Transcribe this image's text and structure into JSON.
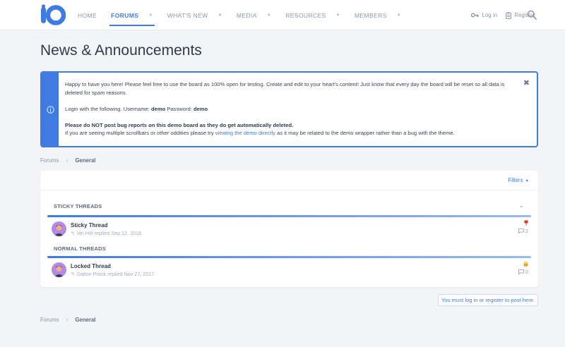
{
  "logo": {
    "text": "iO"
  },
  "nav": {
    "items": [
      {
        "label": "HOME",
        "caret": false,
        "active": false
      },
      {
        "label": "FORUMS",
        "caret": true,
        "active": true
      },
      {
        "label": "WHAT'S NEW",
        "caret": true,
        "active": false
      },
      {
        "label": "MEDIA",
        "caret": true,
        "active": false
      },
      {
        "label": "RESOURCES",
        "caret": true,
        "active": false
      },
      {
        "label": "MEMBERS",
        "caret": true,
        "active": false
      }
    ],
    "login_label": "Log in",
    "register_label": "Register"
  },
  "page": {
    "title": "News & Announcements"
  },
  "notice": {
    "line1": "Happy to have you here! Please feel free to use the board as 100% open for testing. Create and edit to your heart's content! Just know that every day the board will be reset so all data is deleted for spam reasons.",
    "login_prefix": "Login with the following. Username: ",
    "username": "demo",
    "password_prefix": " Password: ",
    "password": "demo",
    "warning": "Please do NOT post bug reports on this demo board as they do get automatically deleted.",
    "scroll_prefix": "If you are seeing multiple scrollbars or other oddities please try ",
    "scroll_link": "viewing the demo directly",
    "scroll_suffix": " as it may be related to the demo wrapper rather than a bug with the theme.",
    "close_glyph": "✖"
  },
  "breadcrumb": {
    "home": "Forums",
    "current": "General"
  },
  "threads": {
    "filters_label": "Filters",
    "sticky_header": "STICKY THREADS",
    "normal_header": "NORMAL THREADS",
    "sticky": [
      {
        "title": "Sticky Thread",
        "author": "Ian Hitt",
        "replied": "replied",
        "date": "Sep 12, 2018",
        "replies": "2",
        "status_icon": "pin-icon"
      }
    ],
    "normal": [
      {
        "title": "Locked Thread",
        "author": "Dalton Prock",
        "replied": "replied",
        "date": "Nov 27, 2017",
        "replies": "0",
        "status_icon": "lock-icon"
      }
    ]
  },
  "post_button": {
    "label": "You must log in or register to post here."
  },
  "colors": {
    "accent": "#3f7be0",
    "background": "#f2f4f8",
    "avatar": "#b38ae8",
    "pin": "#d9342b",
    "lock": "#e0a82e"
  }
}
